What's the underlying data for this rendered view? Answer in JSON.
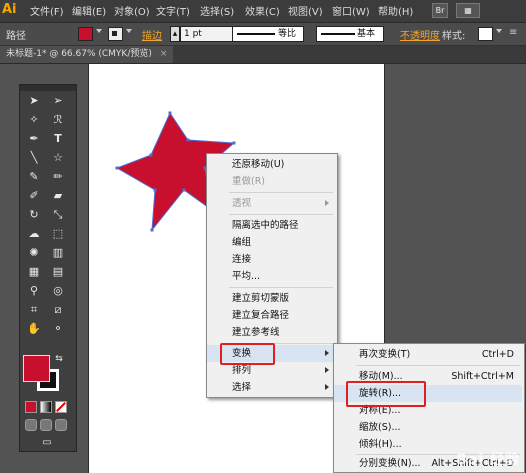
{
  "app": {
    "logo": "Ai"
  },
  "menubar": {
    "items": [
      "文件(F)",
      "编辑(E)",
      "对象(O)",
      "文字(T)",
      "选择(S)",
      "效果(C)",
      "视图(V)",
      "窗口(W)",
      "帮助(H)"
    ],
    "right_icons": [
      "Br",
      "St"
    ]
  },
  "control": {
    "selection_label": "路径",
    "fill_color": "#c8102e",
    "stroke_label": "描边",
    "stroke_width": "1 pt",
    "profile_label": "等比",
    "brush_label": "基本",
    "opacity_label": "不透明度",
    "style_label": "样式:"
  },
  "document": {
    "tab_title": "未标题-1* @ 66.67% (CMYK/预览)",
    "close": "×"
  },
  "shape": {
    "fill": "#c8102e",
    "stroke": "#4a6fd8"
  },
  "toolbox": {
    "tools": [
      "selection",
      "direct-selection",
      "magic-wand",
      "lasso",
      "pen",
      "type",
      "line",
      "star",
      "paintbrush",
      "pencil",
      "blob-brush",
      "eraser",
      "rotate",
      "scale",
      "warp",
      "free-transform",
      "symbol-sprayer",
      "graph",
      "mesh",
      "gradient",
      "eyedropper",
      "blend",
      "artboard",
      "slice",
      "hand",
      "zoom"
    ],
    "fill_color": "#c8102e",
    "stroke_color": "#111111"
  },
  "context_menu": {
    "items": [
      {
        "label": "还原移动(U)",
        "enabled": true
      },
      {
        "label": "重做(R)",
        "enabled": false
      },
      {
        "label": "透视",
        "enabled": false,
        "submenu": true
      },
      {
        "label": "隔离选中的路径",
        "enabled": true
      },
      {
        "label": "编组",
        "enabled": true
      },
      {
        "label": "连接",
        "enabled": true
      },
      {
        "label": "平均...",
        "enabled": true
      },
      {
        "label": "建立剪切蒙版",
        "enabled": true
      },
      {
        "label": "建立复合路径",
        "enabled": true
      },
      {
        "label": "建立参考线",
        "enabled": true
      },
      {
        "label": "变换",
        "enabled": true,
        "submenu": true
      },
      {
        "label": "排列",
        "enabled": true,
        "submenu": true
      },
      {
        "label": "选择",
        "enabled": true,
        "submenu": true
      }
    ]
  },
  "submenu": {
    "items": [
      {
        "label": "再次变换(T)",
        "shortcut": "Ctrl+D"
      },
      {
        "label": "移动(M)...",
        "shortcut": "Shift+Ctrl+M"
      },
      {
        "label": "旋转(R)...",
        "shortcut": ""
      },
      {
        "label": "对称(E)...",
        "shortcut": ""
      },
      {
        "label": "缩放(S)...",
        "shortcut": ""
      },
      {
        "label": "倾斜(H)...",
        "shortcut": ""
      },
      {
        "label": "分别变换(N)...",
        "shortcut": "Alt+Shift+Ctrl+D"
      }
    ]
  },
  "watermark": "Bai 经验"
}
